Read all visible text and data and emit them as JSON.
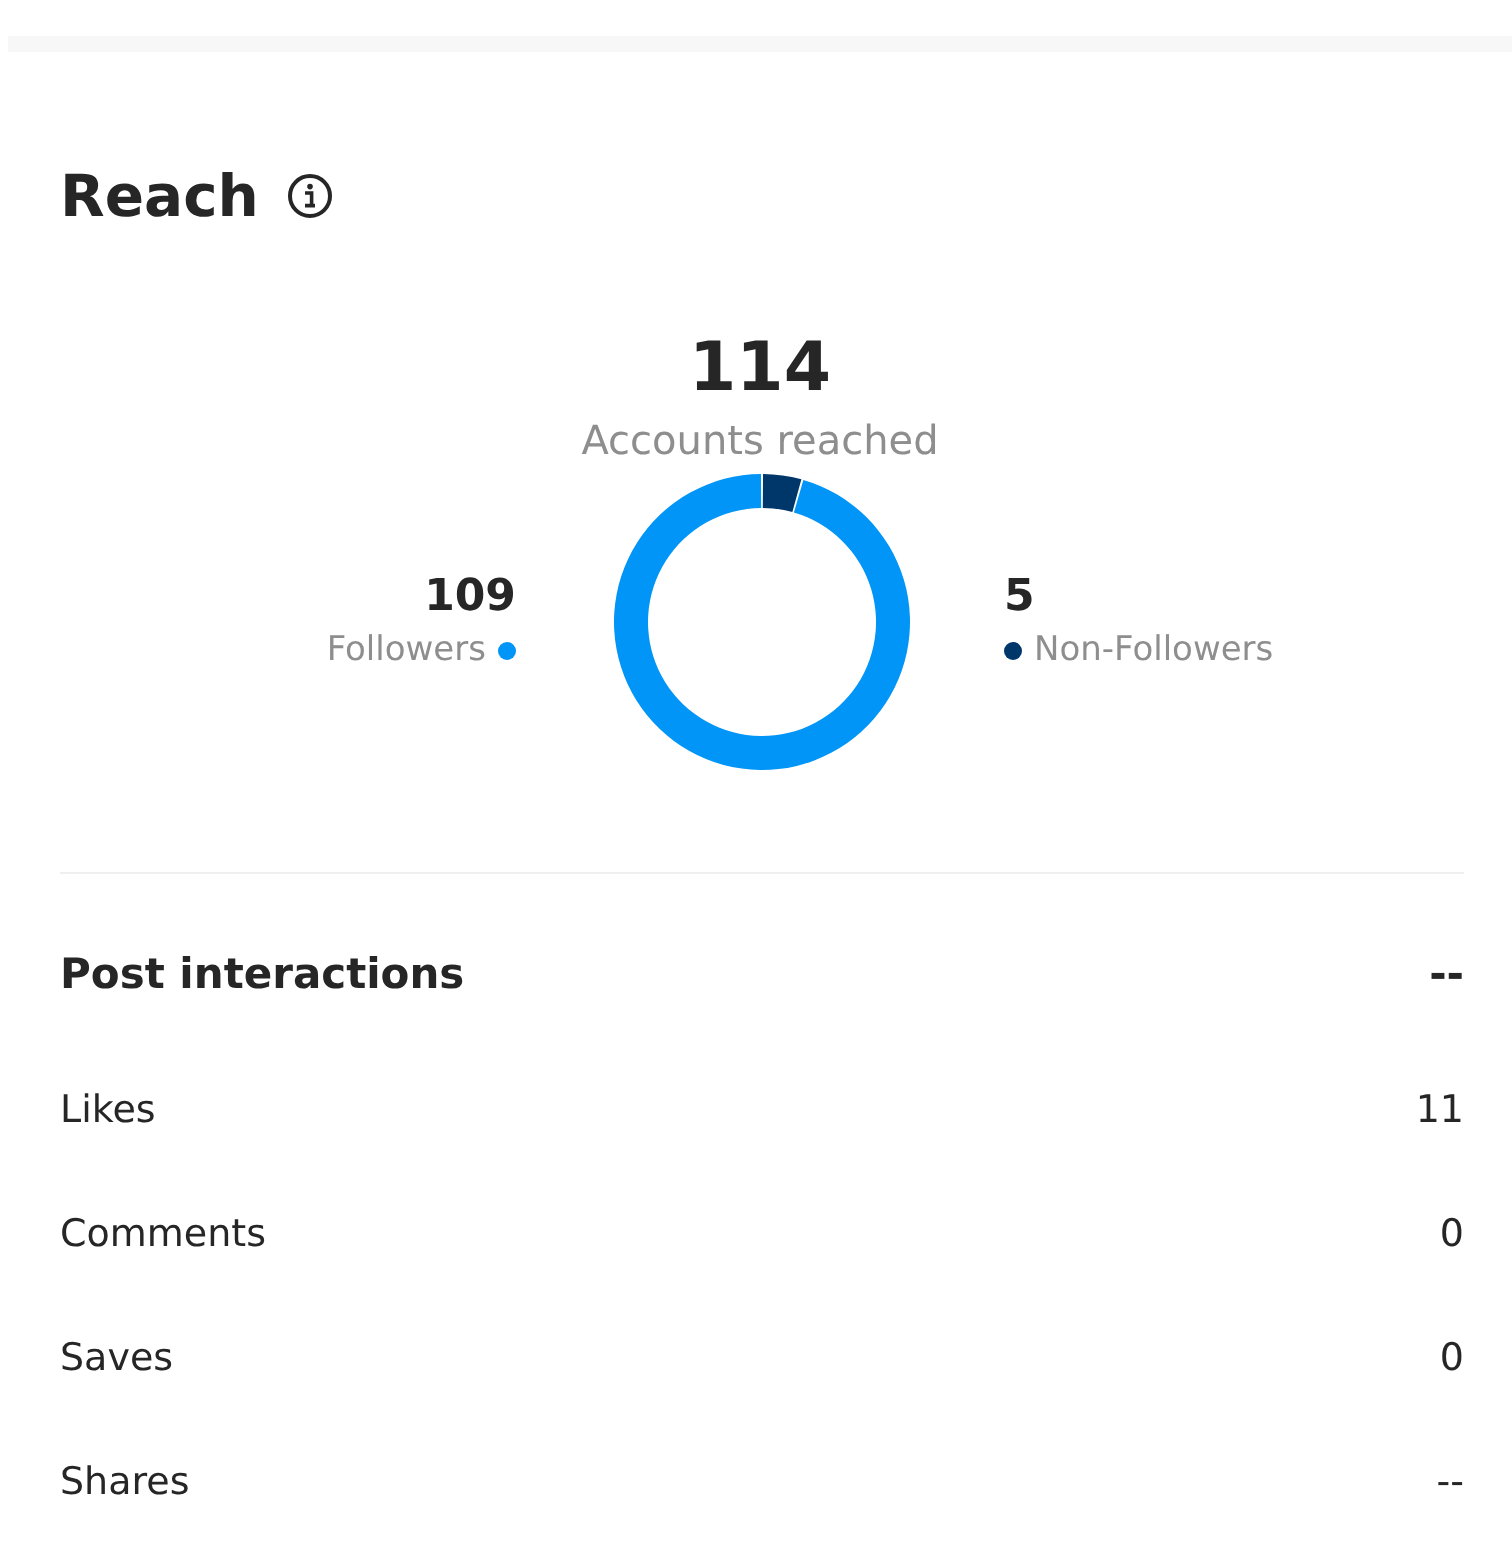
{
  "reach": {
    "title": "Reach",
    "total": "114",
    "total_label": "Accounts reached",
    "legend": [
      {
        "value": "109",
        "color": "#0095f6"
      },
      {
        "value": "5",
        "color": "#00376b"
      }
    ],
    "chart_data": {
      "type": "donut",
      "categories": [
        "Followers",
        "Non-Followers"
      ],
      "values": [
        95.6,
        4.4
      ]
    }
  },
  "post_interactions": {
    "title": "Post interactions",
    "total": "--",
    "rows": [
      {
        "label": "Likes",
        "value": "11"
      },
      {
        "label": "Comments",
        "value": "0"
      },
      {
        "label": "Saves",
        "value": "0"
      },
      {
        "label": "Shares",
        "value": "--"
      }
    ]
  }
}
